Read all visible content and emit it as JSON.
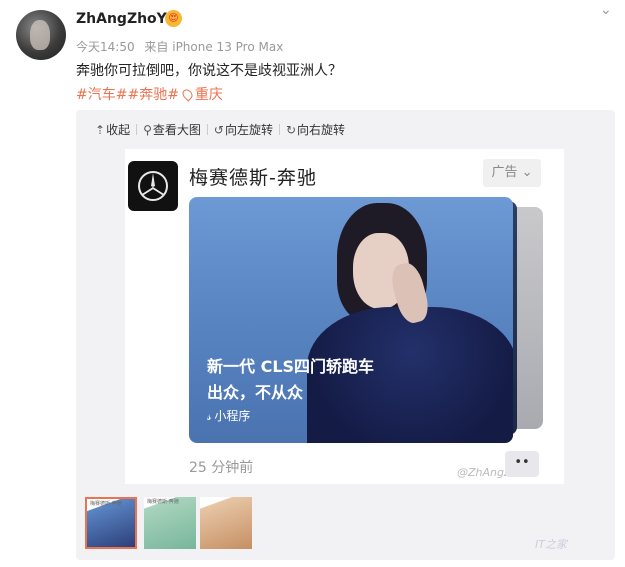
{
  "post": {
    "username": "ZhAngZhoYn",
    "emoji": "😍",
    "time": "今天14:50",
    "source": "来自 iPhone 13 Pro Max",
    "text": "奔驰你可拉倒吧，你说这不是歧视亚洲人？",
    "tags": "#汽车##奔驰#",
    "location": "重庆"
  },
  "toolbar": {
    "collapse": "收起",
    "view_large": "查看大图",
    "rotate_left": "向左旋转",
    "rotate_right": "向右旋转"
  },
  "ad": {
    "brand": "梅赛德斯-奔驰",
    "ad_label": "广告",
    "headline1": "新一代 CLS四门轿跑车",
    "headline2": "出众，不从众",
    "mini_program": "小程序",
    "time_ago": "25 分钟前",
    "more": "••",
    "watermark": "@ZhAngZhoYn"
  },
  "thumbnails": [
    {
      "label": "梅赛德斯-奔驰",
      "selected": true
    },
    {
      "label": "梅赛德斯-奔驰",
      "selected": false
    },
    {
      "label": "",
      "selected": false
    }
  ],
  "corner_watermark": "IT之家",
  "icons": {
    "collapse": "collapse-arrow-icon",
    "zoom": "magnifier-icon",
    "rotate_left": "rotate-left-icon",
    "rotate_right": "rotate-right-icon",
    "location": "location-pin-icon",
    "menu": "chevron-down-icon"
  },
  "colors": {
    "accent": "#eb7350",
    "muted": "#999999"
  }
}
